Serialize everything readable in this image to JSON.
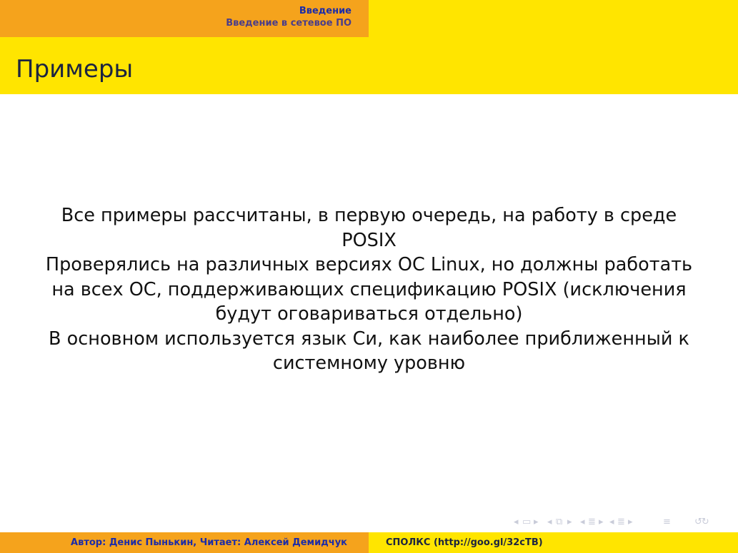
{
  "header": {
    "section": "Введение",
    "subsection": "Введение в сетевое ПО"
  },
  "frame": {
    "title": "Примеры"
  },
  "content": {
    "paragraphs": [
      "Все примеры рассчитаны, в первую очередь, на работу в среде POSIX",
      "Проверялись на различных версиях ОС Linux, но должны работать на всех ОС, поддерживающих спецификацию POSIX (исключения будут оговариваться отдельно)",
      "В основном используется язык Си, как наиболее приближенный к системному уровню"
    ]
  },
  "navigation": {
    "icons": [
      "nav-prev-frame-icon",
      "nav-frame-icon",
      "nav-next-frame-icon",
      "nav-prev-subsection-icon",
      "nav-subsection-icon",
      "nav-next-subsection-icon",
      "nav-prev-section-icon",
      "nav-section-icon",
      "nav-next-section-icon",
      "nav-prev-slide-icon",
      "nav-slide-icon",
      "nav-next-slide-icon",
      "nav-toc-icon",
      "nav-search-icon"
    ]
  },
  "footer": {
    "author": "Автор: Денис Пынькин, Читает: Алексей Демидчук",
    "title": "СПОЛКС (http://goo.gl/32cTB)"
  },
  "colors": {
    "orange": "#f5a31c",
    "yellow": "#ffe500",
    "dark_blue": "#1c2ca8",
    "title_text": "#1c2440",
    "nav_icons": "#c9ccd9"
  }
}
